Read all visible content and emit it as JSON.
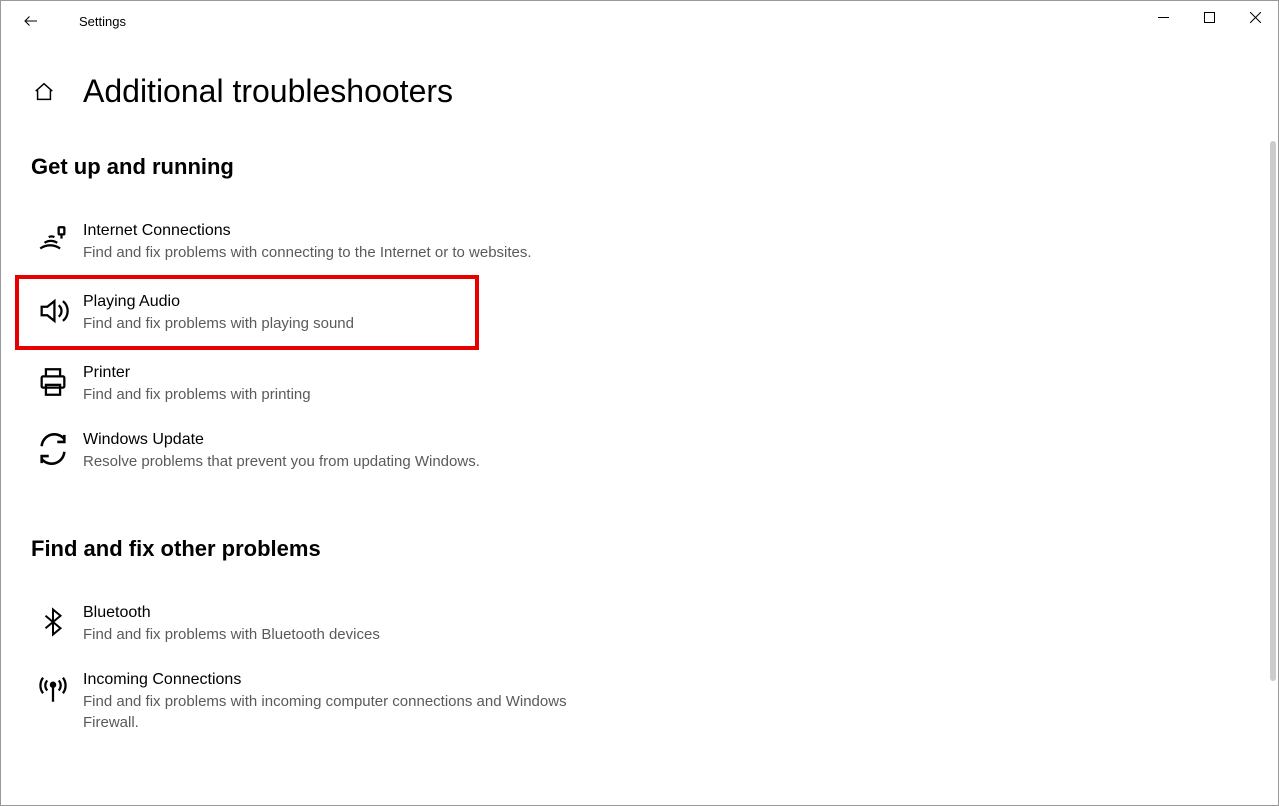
{
  "app": {
    "title": "Settings"
  },
  "page": {
    "heading": "Additional troubleshooters"
  },
  "sections": {
    "running": {
      "title": "Get up and running",
      "items": [
        {
          "title": "Internet Connections",
          "desc": "Find and fix problems with connecting to the Internet or to websites."
        },
        {
          "title": "Playing Audio",
          "desc": "Find and fix problems with playing sound"
        },
        {
          "title": "Printer",
          "desc": "Find and fix problems with printing"
        },
        {
          "title": "Windows Update",
          "desc": "Resolve problems that prevent you from updating Windows."
        }
      ]
    },
    "other": {
      "title": "Find and fix other problems",
      "items": [
        {
          "title": "Bluetooth",
          "desc": "Find and fix problems with Bluetooth devices"
        },
        {
          "title": "Incoming Connections",
          "desc": "Find and fix problems with incoming computer connections and Windows Firewall."
        }
      ]
    }
  }
}
